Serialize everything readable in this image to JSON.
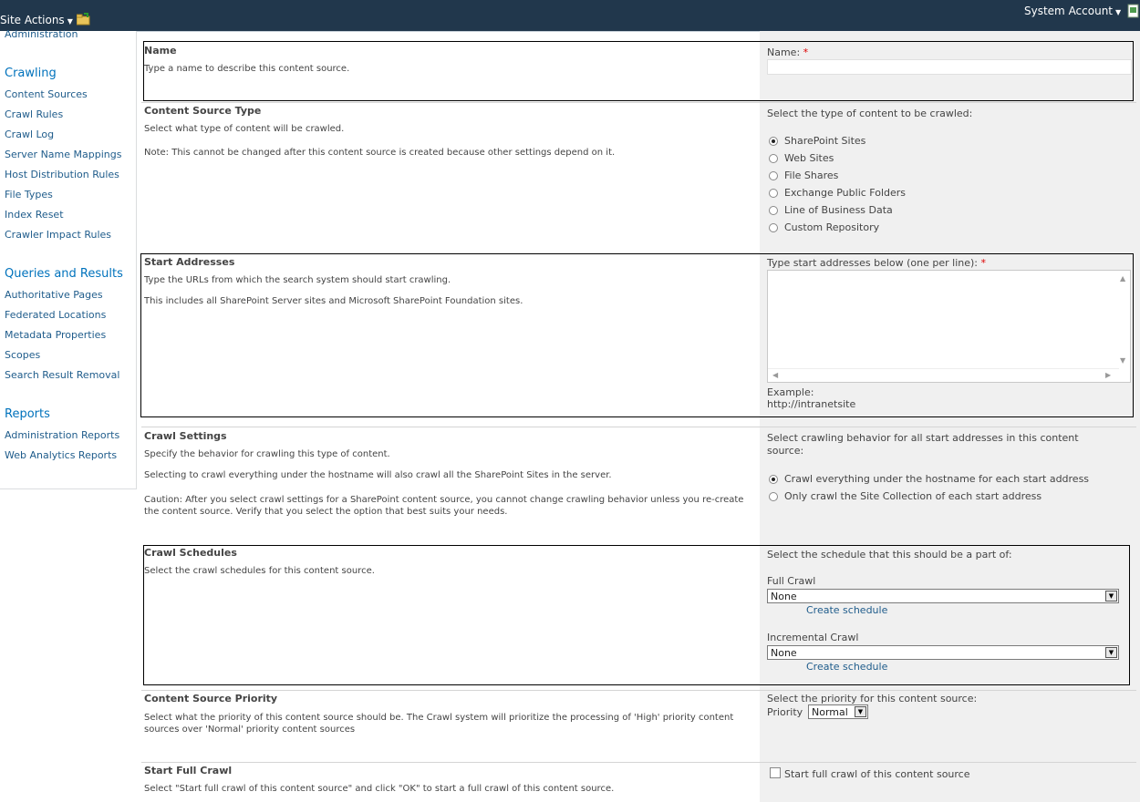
{
  "topbar": {
    "site_actions": "Site Actions",
    "system_account": "System Account"
  },
  "leftnav": {
    "truncated_item": "Administration",
    "crawling_heading": "Crawling",
    "crawling_items": [
      "Content Sources",
      "Crawl Rules",
      "Crawl Log",
      "Server Name Mappings",
      "Host Distribution Rules",
      "File Types",
      "Index Reset",
      "Crawler Impact Rules"
    ],
    "queries_heading": "Queries and Results",
    "queries_items": [
      "Authoritative Pages",
      "Federated Locations",
      "Metadata Properties",
      "Scopes",
      "Search Result Removal"
    ],
    "reports_heading": "Reports",
    "reports_items": [
      "Administration Reports",
      "Web Analytics Reports"
    ]
  },
  "sections": {
    "name": {
      "title": "Name",
      "desc": "Type a name to describe this content source.",
      "field_label": "Name:",
      "required_mark": "*",
      "value": ""
    },
    "content_type": {
      "title": "Content Source Type",
      "desc1": "Select what type of content will be crawled.",
      "desc2": "Note: This cannot be changed after this content source is created because other settings depend on it.",
      "prompt": "Select the type of content to be crawled:",
      "options": [
        "SharePoint Sites",
        "Web Sites",
        "File Shares",
        "Exchange Public Folders",
        "Line of Business Data",
        "Custom Repository"
      ],
      "selected": "SharePoint Sites"
    },
    "start_addresses": {
      "title": "Start Addresses",
      "desc1": "Type the URLs from which the search system should start crawling.",
      "desc2": "This includes all SharePoint Server sites and Microsoft SharePoint Foundation sites.",
      "prompt": "Type start addresses below (one per line):",
      "required_mark": "*",
      "value": "",
      "example_label": "Example:",
      "example_value": "http://intranetsite"
    },
    "crawl_settings": {
      "title": "Crawl Settings",
      "desc1": "Specify the behavior for crawling this type of content.",
      "desc2": "Selecting to crawl everything under the hostname will also crawl all the SharePoint Sites in the server.",
      "desc3": "Caution: After you select crawl settings for a SharePoint content source, you cannot change crawling behavior unless you re-create the content source. Verify that you select the option that best suits your needs.",
      "prompt": "Select crawling behavior for all start addresses in this content source:",
      "options": [
        "Crawl everything under the hostname for each start address",
        "Only crawl the Site Collection of each start address"
      ],
      "selected": "Crawl everything under the hostname for each start address"
    },
    "crawl_schedules": {
      "title": "Crawl Schedules",
      "desc": "Select the crawl schedules for this content source.",
      "prompt": "Select the schedule that this should be a part of:",
      "full_label": "Full Crawl",
      "full_value": "None",
      "full_link": "Create schedule",
      "incr_label": "Incremental Crawl",
      "incr_value": "None",
      "incr_link": "Create schedule"
    },
    "priority": {
      "title": "Content Source Priority",
      "desc": "Select what the priority of this content source should be. The Crawl system will prioritize the processing of 'High' priority content sources over 'Normal' priority content sources",
      "prompt": "Select the priority for this content source:",
      "label": "Priority",
      "value": "Normal"
    },
    "start_full_crawl": {
      "title": "Start Full Crawl",
      "desc": "Select \"Start full crawl of this content source\" and click \"OK\" to start a full crawl of this content source.",
      "checkbox_label": "Start full crawl of this content source",
      "checked": false
    }
  }
}
